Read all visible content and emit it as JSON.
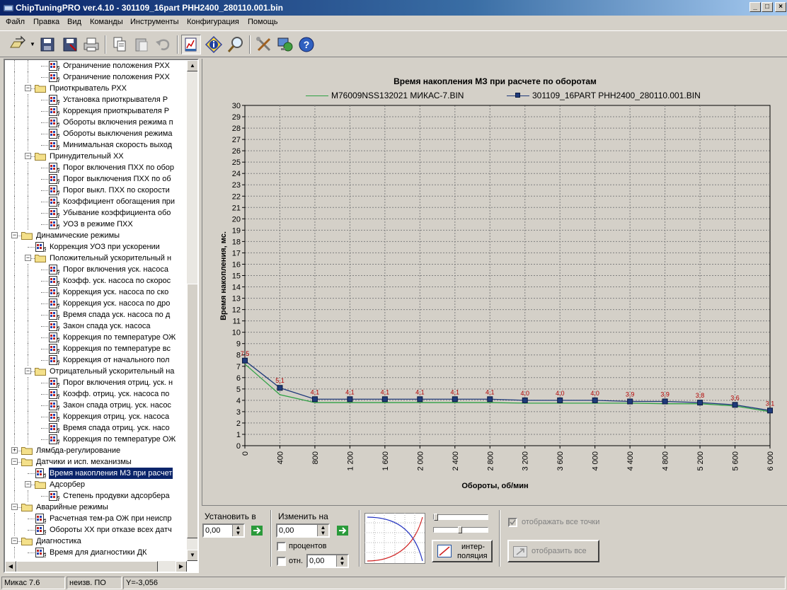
{
  "window": {
    "title": "ChipTuningPRO ver.4.10 - 301109_16part PHH2400_280110.001.bin",
    "min_label": "_",
    "max_label": "□",
    "close_label": "×"
  },
  "menu": [
    "Файл",
    "Правка",
    "Вид",
    "Команды",
    "Инструменты",
    "Конфигурация",
    "Помощь"
  ],
  "toolbar": {
    "icons": [
      "open-icon",
      "save-icon",
      "save-as-icon",
      "print-icon",
      "copy-icon",
      "paste-icon",
      "undo-icon",
      "chart-view-icon",
      "info-icon",
      "search-icon",
      "tools-icon",
      "network-icon",
      "help-icon"
    ]
  },
  "tree": {
    "items": [
      {
        "label": "Ограничение положения РХХ",
        "level": 3,
        "type": "doc"
      },
      {
        "label": "Ограничение положения РХХ",
        "level": 3,
        "type": "doc"
      },
      {
        "label": "Приоткрыватель РХХ",
        "level": 2,
        "type": "folder"
      },
      {
        "label": "Установка приоткрывателя Р",
        "level": 3,
        "type": "doc"
      },
      {
        "label": "Коррекция приоткрывателя Р",
        "level": 3,
        "type": "doc"
      },
      {
        "label": "Обороты включения режима п",
        "level": 3,
        "type": "doc"
      },
      {
        "label": "Обороты выключения режима",
        "level": 3,
        "type": "doc"
      },
      {
        "label": "Минимальная скорость выход",
        "level": 3,
        "type": "doc"
      },
      {
        "label": "Принудительный ХХ",
        "level": 2,
        "type": "folder"
      },
      {
        "label": "Порог включения ПХХ по обор",
        "level": 3,
        "type": "doc"
      },
      {
        "label": "Порог выключения ПХХ по об",
        "level": 3,
        "type": "doc"
      },
      {
        "label": "Порог выкл. ПХХ по скорости",
        "level": 3,
        "type": "doc"
      },
      {
        "label": "Коэффициент обогащения при",
        "level": 3,
        "type": "doc"
      },
      {
        "label": "Убывание коэффициента обо",
        "level": 3,
        "type": "doc"
      },
      {
        "label": "УОЗ в режиме ПХХ",
        "level": 3,
        "type": "doc"
      },
      {
        "label": "Динамические режимы",
        "level": 1,
        "type": "folder"
      },
      {
        "label": "Коррекция УОЗ при ускорении",
        "level": 2,
        "type": "doc"
      },
      {
        "label": "Положительный ускорительный н",
        "level": 2,
        "type": "folder"
      },
      {
        "label": "Порог включения уск. насоса",
        "level": 3,
        "type": "doc"
      },
      {
        "label": "Коэфф. уск. насоса по скорос",
        "level": 3,
        "type": "doc"
      },
      {
        "label": "Коррекция уск. насоса по ско",
        "level": 3,
        "type": "doc"
      },
      {
        "label": "Коррекция уск. насоса по дро",
        "level": 3,
        "type": "doc"
      },
      {
        "label": "Время спада уск. насоса по д",
        "level": 3,
        "type": "doc"
      },
      {
        "label": "Закон спада уск. насоса",
        "level": 3,
        "type": "doc"
      },
      {
        "label": "Коррекция по температуре ОЖ",
        "level": 3,
        "type": "doc"
      },
      {
        "label": "Коррекция по температуре вс",
        "level": 3,
        "type": "doc"
      },
      {
        "label": "Коррекция от начального пол",
        "level": 3,
        "type": "doc"
      },
      {
        "label": "Отрицательный ускорительный на",
        "level": 2,
        "type": "folder"
      },
      {
        "label": "Порог включения отриц. уск. н",
        "level": 3,
        "type": "doc"
      },
      {
        "label": "Коэфф. отриц. уск. насоса по",
        "level": 3,
        "type": "doc"
      },
      {
        "label": "Закон спада отриц. уск. насос",
        "level": 3,
        "type": "doc"
      },
      {
        "label": "Коррекция отриц. уск. насоса",
        "level": 3,
        "type": "doc"
      },
      {
        "label": "Время спада отриц. уск. насо",
        "level": 3,
        "type": "doc"
      },
      {
        "label": "Коррекция по температуре ОЖ",
        "level": 3,
        "type": "doc"
      },
      {
        "label": "Лямбда-регулирование",
        "level": 1,
        "type": "folder",
        "collapsed": true
      },
      {
        "label": "Датчики и исп. механизмы",
        "level": 1,
        "type": "folder"
      },
      {
        "label": "Время накопления МЗ при расчет",
        "level": 2,
        "type": "doc",
        "selected": true
      },
      {
        "label": "Адсорбер",
        "level": 2,
        "type": "folder"
      },
      {
        "label": "Степень продувки адсорбера",
        "level": 3,
        "type": "doc"
      },
      {
        "label": "Аварийные режимы",
        "level": 1,
        "type": "folder"
      },
      {
        "label": "Расчетная тем-ра ОЖ при неиспр",
        "level": 2,
        "type": "doc"
      },
      {
        "label": "Обороты ХХ при отказе всех датч",
        "level": 2,
        "type": "doc"
      },
      {
        "label": "Диагностика",
        "level": 1,
        "type": "folder"
      },
      {
        "label": "Время для диагностики ДК",
        "level": 2,
        "type": "doc"
      }
    ]
  },
  "chart_data": {
    "type": "line",
    "title": "Время накопления МЗ при расчете по оборотам",
    "xlabel": "Обороты, об/мин",
    "ylabel": "Время накопления, мс.",
    "x_ticks": [
      "0",
      "400",
      "800",
      "1 200",
      "1 600",
      "2 000",
      "2 400",
      "2 800",
      "3 200",
      "3 600",
      "4 000",
      "4 400",
      "4 800",
      "5 200",
      "5 600",
      "6 000"
    ],
    "x": [
      0,
      400,
      800,
      1200,
      1600,
      2000,
      2400,
      2800,
      3200,
      3600,
      4000,
      4400,
      4800,
      5200,
      5600,
      6000
    ],
    "ylim": [
      0,
      30
    ],
    "y_ticks": [
      0,
      1,
      2,
      3,
      4,
      5,
      6,
      7,
      8,
      9,
      10,
      11,
      12,
      13,
      14,
      15,
      16,
      17,
      18,
      19,
      20,
      21,
      22,
      23,
      24,
      25,
      26,
      27,
      28,
      29,
      30
    ],
    "grid": true,
    "legend_position": "top",
    "series": [
      {
        "name": "M76009NSS132021 МИКАС-7.BIN",
        "color": "#2ea043",
        "marker": false,
        "values": [
          7.2,
          4.5,
          3.8,
          3.8,
          3.8,
          3.8,
          3.8,
          3.8,
          3.75,
          3.75,
          3.75,
          3.75,
          3.7,
          3.7,
          3.5,
          3.0
        ]
      },
      {
        "name": "301109_16PART PHH2400_280110.001.BIN",
        "color": "#1f3a7a",
        "marker": true,
        "values": [
          7.5,
          5.1,
          4.1,
          4.1,
          4.1,
          4.1,
          4.1,
          4.1,
          4.0,
          4.0,
          4.0,
          3.9,
          3.9,
          3.8,
          3.6,
          3.1
        ],
        "labels": [
          "7,5",
          "5,1",
          "4,1",
          "4,1",
          "4,1",
          "4,1",
          "4,1",
          "4,1",
          "4,0",
          "4,0",
          "4,0",
          "3,9",
          "3,9",
          "3,8",
          "3,6",
          "3,1"
        ]
      }
    ]
  },
  "controls": {
    "set_label": "Установить в",
    "set_value": "0,00",
    "change_label": "Изменить на",
    "change_value": "0,00",
    "percent_label": "процентов",
    "rel_label": "отн.",
    "rel_value": "0,00",
    "interp_label_1": "интер-",
    "interp_label_2": "поляция",
    "show_all_points_label": "отображать все точки",
    "show_all_label": "отобразить все"
  },
  "status": {
    "cell1": "Микас 7.6",
    "cell2": "неизв. ПО",
    "cell3": "Y=-3,056"
  }
}
